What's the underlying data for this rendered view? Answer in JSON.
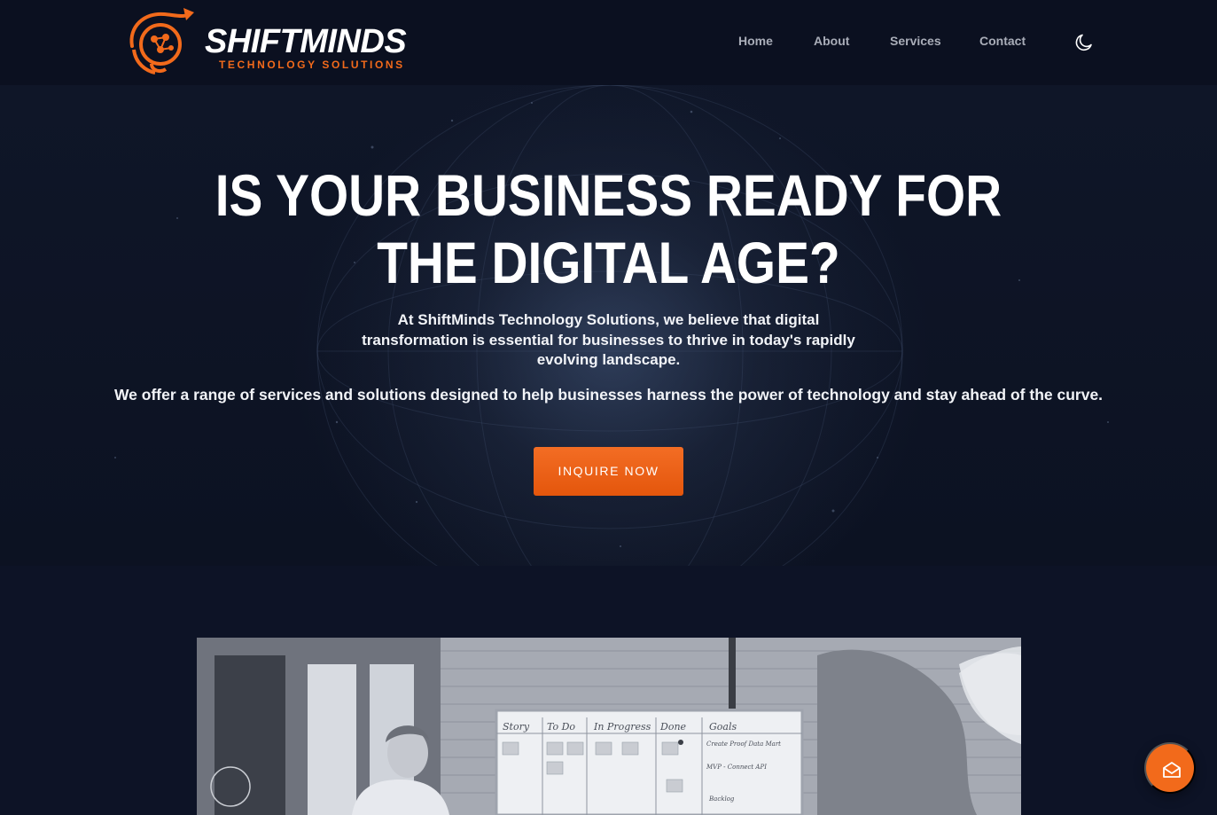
{
  "brand": {
    "name": "SHIFTMINDS",
    "tagline": "TECHNOLOGY  SOLUTIONS",
    "accent": "#f26a1b"
  },
  "nav": {
    "items": [
      {
        "label": "Home"
      },
      {
        "label": "About"
      },
      {
        "label": "Services"
      },
      {
        "label": "Contact"
      }
    ],
    "theme_toggle_icon": "moon-icon"
  },
  "hero": {
    "title_line1": "IS YOUR BUSINESS READY FOR",
    "title_line2": "THE DIGITAL AGE?",
    "paragraph1": "At ShiftMinds Technology Solutions, we believe that digital transformation is essential for businesses to thrive in today's rapidly evolving landscape.",
    "paragraph2": "We offer a range of services and solutions designed to help businesses harness the power of technology and stay ahead of the curve.",
    "cta_label": "INQUIRE NOW"
  },
  "whiteboard": {
    "columns": [
      "Story",
      "To Do",
      "In Progress",
      "Done",
      "Goals"
    ],
    "goal_items": [
      "Create Proof Data Mart",
      "MVP - Connect API",
      "Backlog"
    ]
  },
  "floating_button": {
    "icon": "mail-open-icon",
    "color": "#f26a1b"
  }
}
